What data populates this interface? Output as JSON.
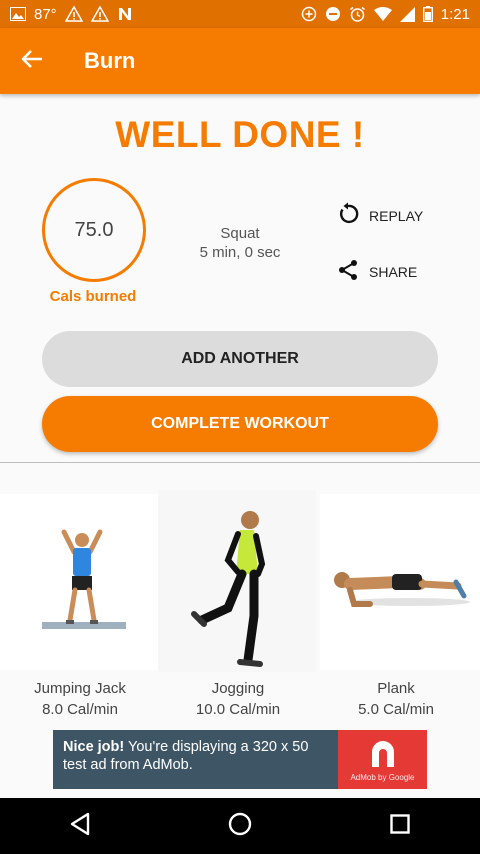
{
  "status_bar": {
    "temperature": "87°",
    "time": "1:21",
    "icons": [
      "image-icon",
      "warning-icon",
      "warning-icon",
      "n-icon",
      "data-saver-icon",
      "dnd-icon",
      "alarm-icon",
      "wifi-icon",
      "signal-icon",
      "battery-icon"
    ]
  },
  "app_bar": {
    "title": "Burn",
    "back_icon": "arrow-back-icon",
    "color": "#f57c00"
  },
  "result": {
    "headline": "WELL DONE !",
    "calories_value": "75.0",
    "calories_label": "Cals burned",
    "exercise_name": "Squat",
    "exercise_duration": "5 min, 0 sec"
  },
  "actions": {
    "replay_label": "REPLAY",
    "share_label": "SHARE"
  },
  "buttons": {
    "add_another": "ADD ANOTHER",
    "complete_workout": "COMPLETE WORKOUT"
  },
  "suggestions": [
    {
      "name": "Jumping Jack",
      "rate": "8.0 Cal/min"
    },
    {
      "name": "Jogging",
      "rate": "10.0 Cal/min"
    },
    {
      "name": "Plank",
      "rate": "5.0 Cal/min"
    }
  ],
  "ad": {
    "headline": "Nice job!",
    "body": " You're displaying a 320 x 50 test ad from AdMob.",
    "logo_caption": "AdMob by Google"
  },
  "nav_bar": {
    "icons": [
      "back-icon",
      "home-icon",
      "recents-icon"
    ]
  }
}
